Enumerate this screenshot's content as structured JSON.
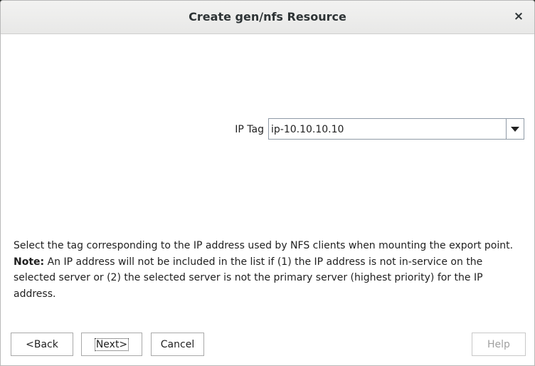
{
  "window": {
    "title": "Create gen/nfs Resource",
    "close_glyph": "×"
  },
  "form": {
    "ip_tag_label": "IP Tag",
    "ip_tag_value": "ip-10.10.10.10"
  },
  "help": {
    "line1": "Select the tag corresponding to the IP address used by NFS clients when mounting the export point.",
    "note_label": "Note:",
    "note_text": " An IP address will not be included in the list if (1) the IP address is not in-service on the selected server or (2) the selected server is not the primary server (highest priority) for the IP address."
  },
  "buttons": {
    "back": "<Back",
    "next": "Next>",
    "cancel": "Cancel",
    "help": "Help"
  },
  "icons": {
    "close": "close-icon",
    "dropdown": "chevron-down-icon"
  }
}
